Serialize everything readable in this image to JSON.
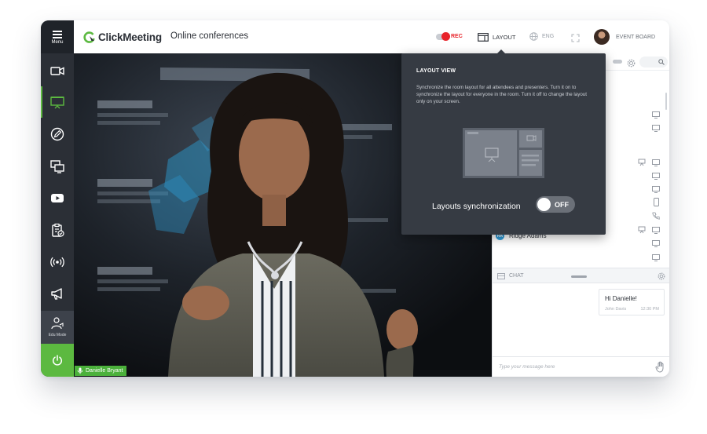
{
  "app": {
    "brand": "ClickMeeting",
    "conference_title": "Online conferences"
  },
  "sidebar": {
    "menu_label": "Menu",
    "items": [
      {
        "icon": "camera-icon",
        "active": false
      },
      {
        "icon": "presentation-icon",
        "active": true
      },
      {
        "icon": "whiteboard-pen-icon",
        "active": false
      },
      {
        "icon": "screen-share-icon",
        "active": false
      },
      {
        "icon": "youtube-icon",
        "active": false
      },
      {
        "icon": "clipboard-check-icon",
        "active": false
      },
      {
        "icon": "broadcast-icon",
        "active": false
      },
      {
        "icon": "megaphone-icon",
        "active": false
      }
    ],
    "edu_mode_label": "Edu Mode",
    "power_icon": "power-icon"
  },
  "topbar": {
    "rec_label": "REC",
    "layout_label": "LAYOUT",
    "language_label": "ENG",
    "event_board_label": "EVENT BOARD"
  },
  "stage": {
    "presenter_name": "Danielle Bryant"
  },
  "layout_popover": {
    "title": "LAYOUT VIEW",
    "description": "Synchronize the room layout for all attendees and presenters. Turn it on to synchronize the layout for everyone in the room. Turn it off to change the layout only on your screen.",
    "sync_label": "Layouts synchronization",
    "sync_state": "OFF"
  },
  "attendees": {
    "visible_name": "Ridge Adams",
    "visible_initials": "RA"
  },
  "chat": {
    "header_label": "CHAT",
    "messages": [
      {
        "text": "Hi Danielle!",
        "author": "John Davis",
        "time": "12:30 PM"
      }
    ],
    "input_placeholder": "Type your message here"
  },
  "colors": {
    "brand_green": "#5cb940",
    "sidebar_dark": "#2b2f36",
    "rec_red": "#e8232a",
    "popover_bg": "#363b43"
  }
}
